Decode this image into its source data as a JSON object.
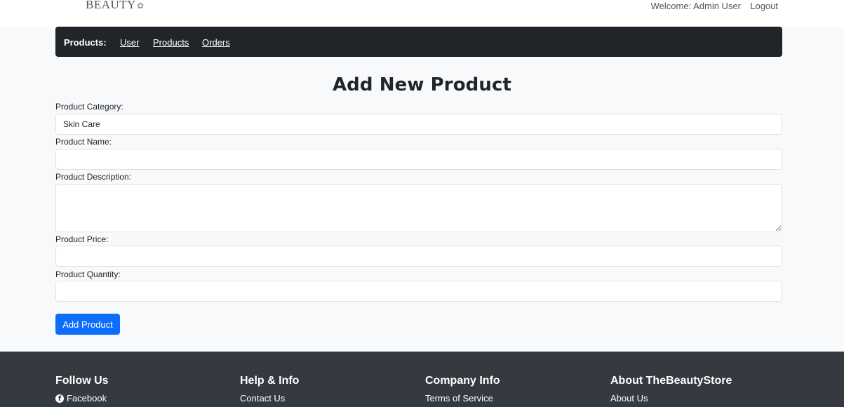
{
  "header": {
    "logo_text": "BEAUTY",
    "welcome_text": "Welcome: Admin User",
    "logout_label": "Logout"
  },
  "navbar": {
    "brand": "Products:",
    "links": [
      {
        "label": "User"
      },
      {
        "label": "Products"
      },
      {
        "label": "Orders"
      }
    ]
  },
  "form": {
    "title": "Add New Product",
    "fields": {
      "category": {
        "label": "Product Category:",
        "value": "Skin Care"
      },
      "name": {
        "label": "Product Name:",
        "value": ""
      },
      "description": {
        "label": "Product Description:",
        "value": ""
      },
      "price": {
        "label": "Product Price:",
        "value": ""
      },
      "quantity": {
        "label": "Product Quantity:",
        "value": ""
      }
    },
    "submit_label": "Add Product"
  },
  "footer": {
    "columns": [
      {
        "heading": "Follow Us",
        "link": "Facebook",
        "icon": "facebook-icon"
      },
      {
        "heading": "Help & Info",
        "link": "Contact Us"
      },
      {
        "heading": "Company Info",
        "link": "Terms of Service"
      },
      {
        "heading": "About TheBeautyStore",
        "link": "About Us"
      }
    ]
  },
  "colors": {
    "page_bg": "#f8f9fa",
    "navbar_bg": "#212529",
    "footer_bg": "#343a40",
    "primary": "#0d6efd"
  }
}
